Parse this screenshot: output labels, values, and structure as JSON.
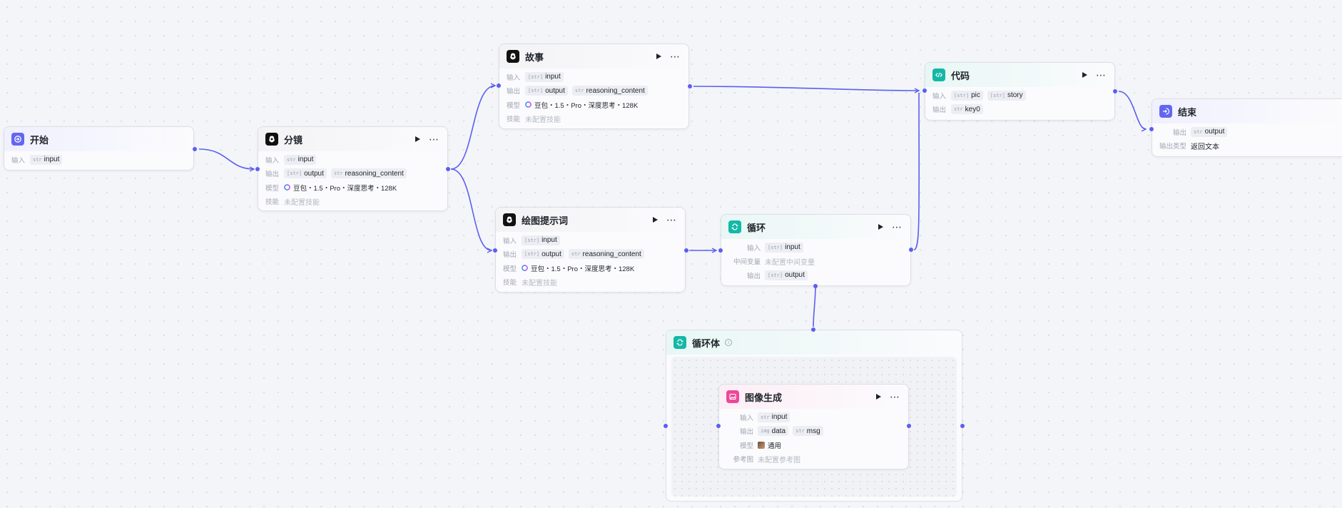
{
  "colors": {
    "edge": "#5b5ff0",
    "llm_icon": "#111111",
    "start_end_icon": "#6366f1",
    "loop_icon": "#14b8a6",
    "code_icon": "#14b8a6",
    "image_icon": "#ec4899"
  },
  "labels": {
    "input": "输入",
    "output": "输出",
    "model": "模型",
    "skill": "技能",
    "output_type": "输出类型",
    "middle_var": "中间变量",
    "ref_image": "参考图"
  },
  "nodes": {
    "start": {
      "title": "开始",
      "icon": "enter-icon",
      "inputs": [
        {
          "type": "str",
          "name": "input"
        }
      ]
    },
    "storyboard": {
      "title": "分镜",
      "icon": "llm-icon",
      "inputs": [
        {
          "type": "str",
          "name": "input"
        }
      ],
      "outputs": [
        {
          "type": "[str]",
          "name": "output"
        },
        {
          "type": "str",
          "name": "reasoning_content"
        }
      ],
      "model": "豆包・1.5・Pro・深度思考・128K",
      "skill": "未配置技能"
    },
    "story": {
      "title": "故事",
      "icon": "llm-icon",
      "inputs": [
        {
          "type": "[str]",
          "name": "input"
        }
      ],
      "outputs": [
        {
          "type": "[str]",
          "name": "output"
        },
        {
          "type": "str",
          "name": "reasoning_content"
        }
      ],
      "model": "豆包・1.5・Pro・深度思考・128K",
      "skill": "未配置技能"
    },
    "prompt": {
      "title": "绘图提示词",
      "icon": "llm-icon",
      "inputs": [
        {
          "type": "[str]",
          "name": "input"
        }
      ],
      "outputs": [
        {
          "type": "[str]",
          "name": "output"
        },
        {
          "type": "str",
          "name": "reasoning_content"
        }
      ],
      "model": "豆包・1.5・Pro・深度思考・128K",
      "skill": "未配置技能"
    },
    "loop": {
      "title": "循环",
      "icon": "loop-icon",
      "inputs": [
        {
          "type": "[str]",
          "name": "input"
        }
      ],
      "middle_var": "未配置中间变量",
      "outputs": [
        {
          "type": "[str]",
          "name": "output"
        }
      ]
    },
    "code": {
      "title": "代码",
      "icon": "code-icon",
      "inputs": [
        {
          "type": "[str]",
          "name": "pic"
        },
        {
          "type": "[str]",
          "name": "story"
        }
      ],
      "outputs": [
        {
          "type": "str",
          "name": "key0"
        }
      ]
    },
    "end": {
      "title": "结束",
      "icon": "exit-icon",
      "outputs": [
        {
          "type": "str",
          "name": "output"
        }
      ],
      "output_type": "返回文本"
    },
    "loop_body": {
      "title": "循环体",
      "icon": "loop-icon"
    },
    "image_gen": {
      "title": "图像生成",
      "icon": "image-icon",
      "inputs": [
        {
          "type": "str",
          "name": "input"
        }
      ],
      "outputs": [
        {
          "type": "img",
          "name": "data"
        },
        {
          "type": "str",
          "name": "msg"
        }
      ],
      "model": "通用",
      "ref_image": "未配置参考图"
    }
  }
}
